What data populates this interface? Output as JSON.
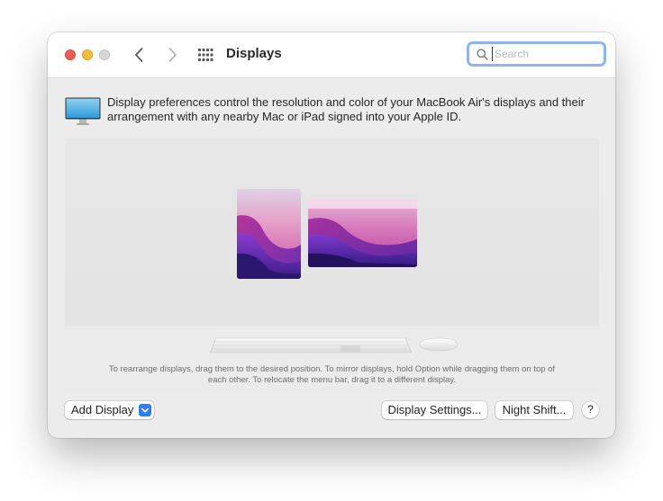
{
  "window": {
    "title": "Displays"
  },
  "search": {
    "placeholder": "Search",
    "value": ""
  },
  "info": {
    "text": "Display preferences control the resolution and color of your MacBook Air's displays and their arrangement with any nearby Mac or iPad signed into your Apple ID."
  },
  "arrangement": {
    "hint": "To rearrange displays, drag them to the desired position. To mirror displays, hold Option while dragging them on top of each other. To relocate the menu bar, drag it to a different display."
  },
  "buttons": {
    "add_display": "Add Display",
    "display_settings": "Display Settings...",
    "night_shift": "Night Shift...",
    "help": "?"
  },
  "colors": {
    "accent": "#2f7df6",
    "search_focus_ring": "#8fb3ee",
    "close_light": "#ee5d52",
    "minimize_light": "#f4bd37",
    "zoom_light": "#d6d6d6"
  },
  "icons": {
    "back": "chevron-left-icon",
    "forward": "chevron-right-icon",
    "show_all": "grid-icon",
    "search": "search-icon",
    "info": "monitor-icon",
    "add_display_menu": "chevron-down-icon"
  }
}
